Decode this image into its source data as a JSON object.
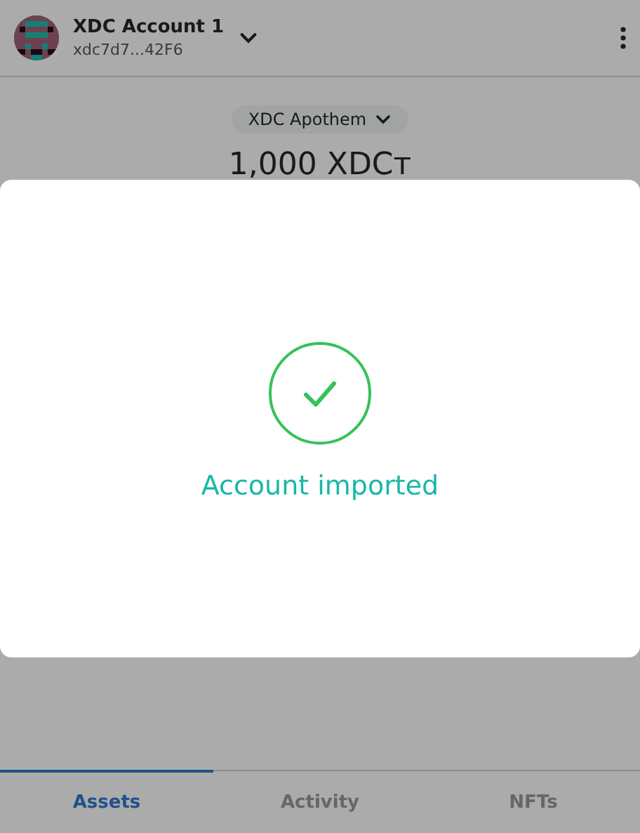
{
  "account": {
    "name": "XDC Account 1",
    "address": "xdc7d7...42F6"
  },
  "network": {
    "label": "XDC Apothem"
  },
  "balance": "1,000 XDCт",
  "dialog": {
    "message": "Account imported"
  },
  "tabs": [
    {
      "label": "Assets",
      "selected": true
    },
    {
      "label": "Activity",
      "selected": false
    },
    {
      "label": "NFTs",
      "selected": false
    }
  ]
}
